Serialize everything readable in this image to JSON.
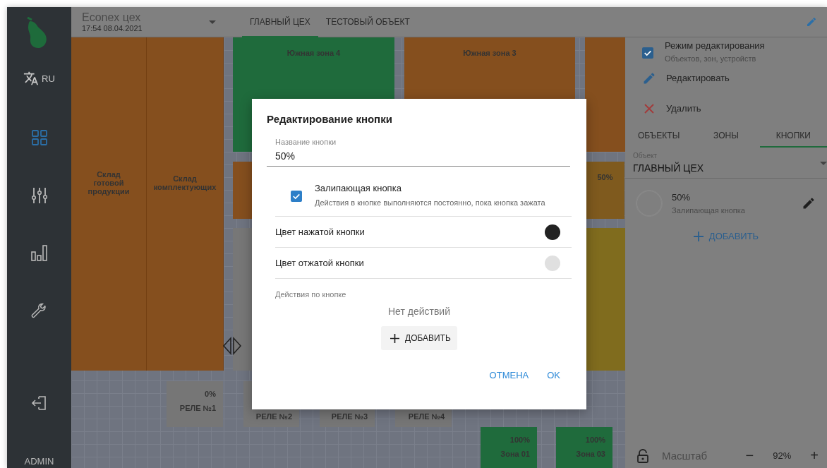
{
  "sidebar": {
    "language": "RU",
    "nav": [
      {
        "selected": true
      },
      {
        "selected": false
      },
      {
        "selected": false
      },
      {
        "selected": false
      }
    ],
    "user": "ADMIN"
  },
  "top_bar": {
    "title": "Econex цех",
    "datetime": "17:54 08.04.2021",
    "tabs": [
      {
        "label": "ГЛАВНЫЙ ЦЕХ",
        "selected": true
      },
      {
        "label": "ТЕСТОВЫЙ ОБЪЕКТ",
        "selected": false
      }
    ]
  },
  "map": {
    "zones": [
      {
        "kind": "storage",
        "label": "Склад готовой продукции",
        "color": "#854f1e"
      },
      {
        "kind": "storage",
        "label": "Склад комплектующих",
        "color": "#854f1e"
      },
      {
        "kind": "area",
        "label": "Южная зона 4",
        "color": "#1f6b3c"
      },
      {
        "kind": "area",
        "label": "Южная зона 3",
        "color": "#854f1e"
      },
      {
        "kind": "area",
        "color": "#854f1e"
      },
      {
        "kind": "area",
        "color": "#854f1e"
      },
      {
        "kind": "area",
        "label": "50%",
        "color": "#7f5a1e"
      },
      {
        "kind": "area",
        "color": "#806c1e"
      },
      {
        "kind": "area",
        "color": "#777777"
      },
      {
        "kind": "relay",
        "value": "0%",
        "label": "РЕЛЕ №1",
        "color": "#767676"
      },
      {
        "kind": "relay",
        "label": "РЕЛЕ №2",
        "color": "#767676"
      },
      {
        "kind": "relay",
        "label": "РЕЛЕ №3",
        "color": "#767676"
      },
      {
        "kind": "relay",
        "label": "РЕЛЕ №4",
        "color": "#767676"
      },
      {
        "kind": "relay",
        "value": "100%",
        "label": "Зона 01",
        "color": "#1f6b3c"
      },
      {
        "kind": "relay",
        "value": "100%",
        "label": "Зона 03",
        "color": "#1f6b3c"
      }
    ]
  },
  "right_panel": {
    "edit_mode": {
      "label": "Режим редактирования",
      "hint": "Объектов, зон, устройств",
      "checked": true
    },
    "actions": [
      {
        "kind": "edit",
        "label": "Редактировать"
      },
      {
        "kind": "delete",
        "label": "Удалить"
      }
    ],
    "tabs": [
      {
        "label": "ОБЪЕКТЫ",
        "selected": false
      },
      {
        "label": "ЗОНЫ",
        "selected": false
      },
      {
        "label": "КНОПКИ",
        "selected": true
      }
    ],
    "object_select": {
      "label": "Объект",
      "value": "ГЛАВНЫЙ ЦЕХ"
    },
    "buttons": [
      {
        "name": "50%",
        "type": "Залипающая кнопка"
      }
    ],
    "add": "ДОБАВИТЬ",
    "zoom": {
      "label": "Масштаб",
      "minus": "−",
      "value": "92%",
      "plus": "+"
    }
  },
  "dialog": {
    "title": "Редактирование кнопки",
    "name_field": {
      "label": "Название кнопки",
      "value": "50%"
    },
    "sticky": {
      "label": "Залипающая кнопка",
      "hint": "Действия в кнопке выполняются постоянно, пока кнопка зажата",
      "checked": true
    },
    "colors": [
      {
        "label": "Цвет нажатой кнопки",
        "color": "#222222"
      },
      {
        "label": "Цвет отжатой кнопки",
        "color": "#e0e0e0"
      }
    ],
    "actions_label": "Действия по кнопке",
    "actions_empty": "Нет действий",
    "add": "ДОБАВИТЬ",
    "buttons": [
      "ОТМЕНА",
      "OK"
    ]
  }
}
